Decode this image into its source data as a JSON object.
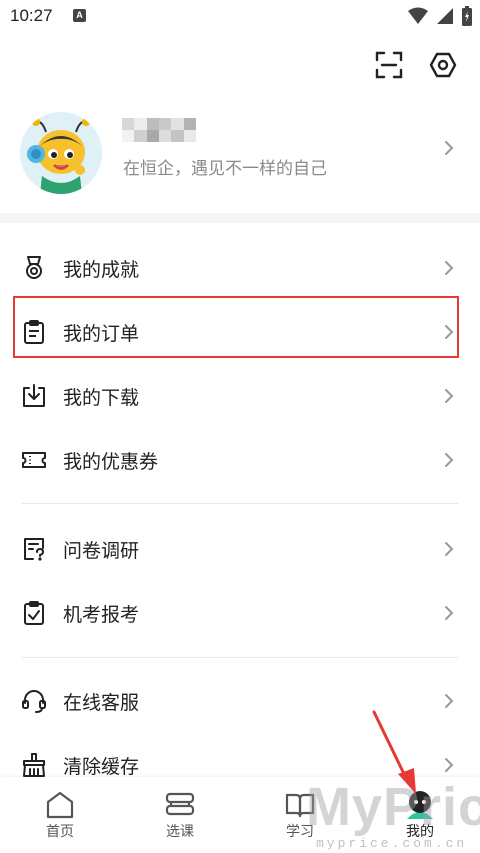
{
  "status_bar": {
    "time": "10:27",
    "notif_glyph": "A",
    "icons": [
      "wifi-icon",
      "signal-icon",
      "battery-icon"
    ]
  },
  "header": {
    "actions": [
      "scan-icon",
      "settings-icon"
    ]
  },
  "profile": {
    "subtitle": "在恒企，遇见不一样的自己"
  },
  "menu": {
    "groups": [
      [
        {
          "label": "我的成就",
          "icon": "medal-icon"
        },
        {
          "label": "我的订单",
          "icon": "order-clipboard-icon"
        },
        {
          "label": "我的下载",
          "icon": "download-icon"
        },
        {
          "label": "我的优惠券",
          "icon": "coupon-icon"
        }
      ],
      [
        {
          "label": "问卷调研",
          "icon": "survey-icon"
        },
        {
          "label": "机考报考",
          "icon": "exam-checklist-icon"
        }
      ],
      [
        {
          "label": "在线客服",
          "icon": "headset-icon"
        },
        {
          "label": "清除缓存",
          "icon": "broom-icon"
        }
      ]
    ]
  },
  "tabbar": {
    "tabs": [
      {
        "label": "首页",
        "icon": "home-icon"
      },
      {
        "label": "选课",
        "icon": "course-stack-icon"
      },
      {
        "label": "学习",
        "icon": "book-icon"
      },
      {
        "label": "我的",
        "icon": "profile-icon",
        "active": true
      }
    ]
  },
  "overlay": {
    "watermark": "MyPrice",
    "watermark_url": "myprice.com.cn"
  },
  "colors": {
    "accent_teal": "#2ec4a4",
    "highlight_red": "#e53935",
    "text_primary": "#222222",
    "text_secondary": "#8a8a8a"
  }
}
